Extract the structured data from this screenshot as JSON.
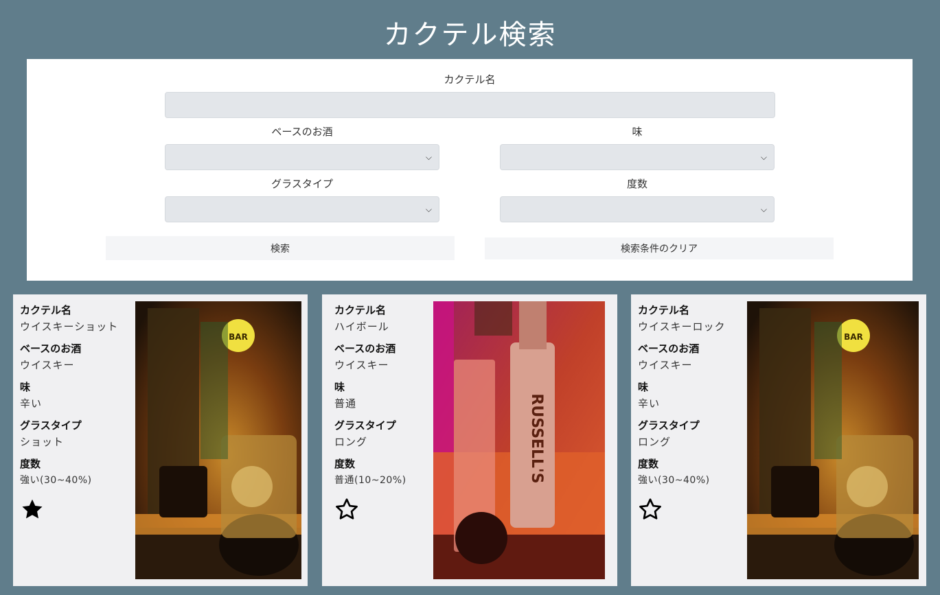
{
  "page": {
    "title": "カクテル検索"
  },
  "search": {
    "name_label": "カクテル名",
    "name_value": "",
    "base_label": "ベースのお酒",
    "taste_label": "味",
    "glass_label": "グラスタイプ",
    "strength_label": "度数",
    "select_icon": "chevron-down-icon",
    "search_button": "検索",
    "clear_button": "検索条件のクリア"
  },
  "labels": {
    "name": "カクテル名",
    "base": "ベースのお酒",
    "taste": "味",
    "glass": "グラスタイプ",
    "strength": "度数"
  },
  "cards": [
    {
      "name": "ウイスキーショット",
      "base": "ウイスキー",
      "taste": "辛い",
      "glass": "ショット",
      "strength": "強い(30~40%)",
      "favorite": true
    },
    {
      "name": "ハイボール",
      "base": "ウイスキー",
      "taste": "普通",
      "glass": "ロング",
      "strength": "普通(10~20%)",
      "favorite": false
    },
    {
      "name": "ウイスキーロック",
      "base": "ウイスキー",
      "taste": "辛い",
      "glass": "ロング",
      "strength": "強い(30~40%)",
      "favorite": false
    }
  ],
  "colors": {
    "background": "#607d8b",
    "panel": "#ffffff",
    "card": "#f0f0f2",
    "input": "#e3e6ea"
  }
}
